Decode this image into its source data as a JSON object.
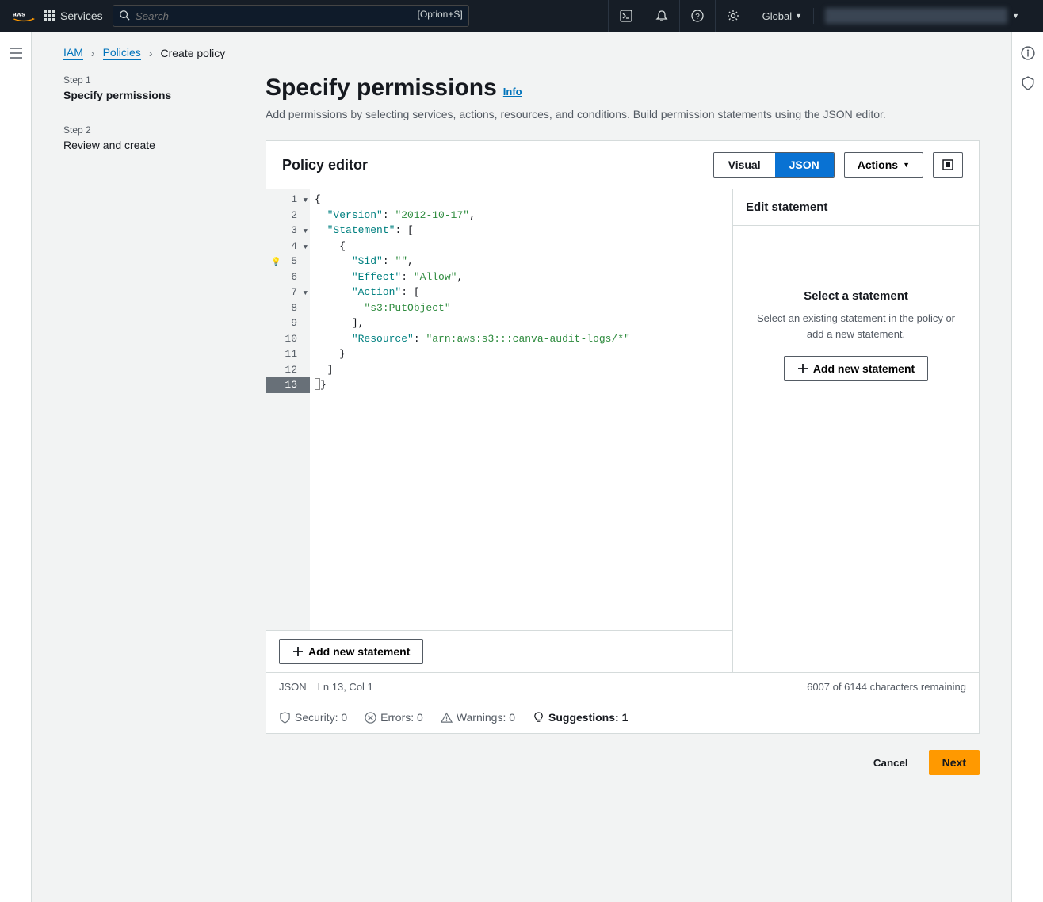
{
  "topnav": {
    "services": "Services",
    "search_placeholder": "Search",
    "search_shortcut": "[Option+S]",
    "region": "Global"
  },
  "breadcrumb": {
    "iam": "IAM",
    "policies": "Policies",
    "current": "Create policy"
  },
  "steps": {
    "s1_label": "Step 1",
    "s1_title": "Specify permissions",
    "s2_label": "Step 2",
    "s2_title": "Review and create"
  },
  "page": {
    "title": "Specify permissions",
    "info": "Info",
    "desc": "Add permissions by selecting services, actions, resources, and conditions. Build permission statements using the JSON editor."
  },
  "editor_panel": {
    "title": "Policy editor",
    "visual": "Visual",
    "json": "JSON",
    "actions": "Actions",
    "add_stmt": "Add new statement",
    "status_lang": "JSON",
    "status_pos": "Ln 13, Col 1",
    "status_chars": "6007 of 6144 characters remaining",
    "side_header": "Edit statement",
    "side_title": "Select a statement",
    "side_desc": "Select an existing statement in the policy or add a new statement.",
    "side_add": "Add new statement"
  },
  "checks": {
    "security": "Security: 0",
    "errors": "Errors: 0",
    "warnings": "Warnings: 0",
    "suggestions": "Suggestions: 1"
  },
  "footer": {
    "cancel": "Cancel",
    "next": "Next"
  },
  "policy_lines": [
    {
      "n": 1,
      "fold": true,
      "tokens": [
        {
          "t": "punc",
          "v": "{"
        }
      ]
    },
    {
      "n": 2,
      "tokens": [
        {
          "t": "sp",
          "v": "  "
        },
        {
          "t": "key",
          "v": "\"Version\""
        },
        {
          "t": "punc",
          "v": ": "
        },
        {
          "t": "str",
          "v": "\"2012-10-17\""
        },
        {
          "t": "punc",
          "v": ","
        }
      ]
    },
    {
      "n": 3,
      "fold": true,
      "tokens": [
        {
          "t": "sp",
          "v": "  "
        },
        {
          "t": "key",
          "v": "\"Statement\""
        },
        {
          "t": "punc",
          "v": ": ["
        }
      ]
    },
    {
      "n": 4,
      "fold": true,
      "tokens": [
        {
          "t": "sp",
          "v": "    "
        },
        {
          "t": "punc",
          "v": "{"
        }
      ]
    },
    {
      "n": 5,
      "bulb": true,
      "tokens": [
        {
          "t": "sp",
          "v": "      "
        },
        {
          "t": "key",
          "v": "\"Sid\""
        },
        {
          "t": "punc",
          "v": ": "
        },
        {
          "t": "str",
          "v": "\"\""
        },
        {
          "t": "punc",
          "v": ","
        }
      ]
    },
    {
      "n": 6,
      "tokens": [
        {
          "t": "sp",
          "v": "      "
        },
        {
          "t": "key",
          "v": "\"Effect\""
        },
        {
          "t": "punc",
          "v": ": "
        },
        {
          "t": "str",
          "v": "\"Allow\""
        },
        {
          "t": "punc",
          "v": ","
        }
      ]
    },
    {
      "n": 7,
      "fold": true,
      "tokens": [
        {
          "t": "sp",
          "v": "      "
        },
        {
          "t": "key",
          "v": "\"Action\""
        },
        {
          "t": "punc",
          "v": ": ["
        }
      ]
    },
    {
      "n": 8,
      "tokens": [
        {
          "t": "sp",
          "v": "        "
        },
        {
          "t": "str",
          "v": "\"s3:PutObject\""
        }
      ]
    },
    {
      "n": 9,
      "tokens": [
        {
          "t": "sp",
          "v": "      "
        },
        {
          "t": "punc",
          "v": "],"
        }
      ]
    },
    {
      "n": 10,
      "tokens": [
        {
          "t": "sp",
          "v": "      "
        },
        {
          "t": "key",
          "v": "\"Resource\""
        },
        {
          "t": "punc",
          "v": ": "
        },
        {
          "t": "str",
          "v": "\"arn:aws:s3:::canva-audit-logs/*\""
        }
      ]
    },
    {
      "n": 11,
      "tokens": [
        {
          "t": "sp",
          "v": "    "
        },
        {
          "t": "punc",
          "v": "}"
        }
      ]
    },
    {
      "n": 12,
      "tokens": [
        {
          "t": "sp",
          "v": "  "
        },
        {
          "t": "punc",
          "v": "]"
        }
      ]
    },
    {
      "n": 13,
      "active": true,
      "cursor": true,
      "tokens": [
        {
          "t": "punc",
          "v": "}"
        }
      ]
    }
  ]
}
